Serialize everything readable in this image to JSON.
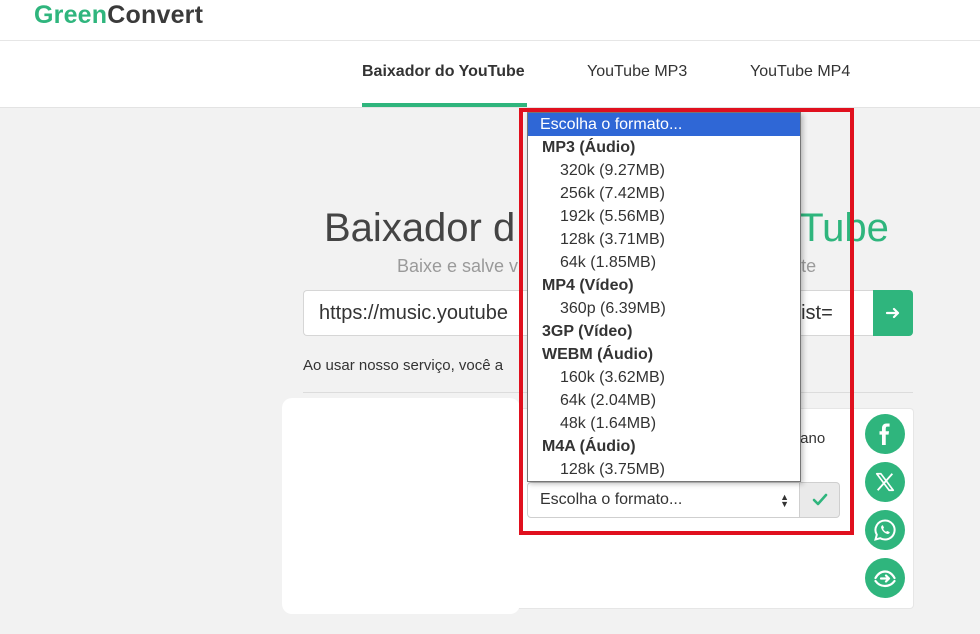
{
  "brand": {
    "part1": "Green",
    "part2": "Convert"
  },
  "nav": [
    {
      "label": "Baixador do YouTube",
      "active": true
    },
    {
      "label": "YouTube MP3",
      "active": false
    },
    {
      "label": "YouTube MP4",
      "active": false
    }
  ],
  "hero": {
    "title_left": "Baixador d",
    "title_right": "Tube",
    "subtitle_left": "Baixe e salve v",
    "subtitle_right": "te"
  },
  "url_input": {
    "value_left": "https://music.youtube",
    "value_right": "A&list="
  },
  "terms_text": "Ao usar nosso serviço, você a",
  "result": {
    "title_fragment": "fano"
  },
  "format_select": {
    "selected": "Escolha o formato...",
    "options": [
      {
        "kind": "selected",
        "label": "Escolha o formato..."
      },
      {
        "kind": "group",
        "label": "MP3 (Áudio)"
      },
      {
        "kind": "item",
        "label": "320k (9.27MB)"
      },
      {
        "kind": "item",
        "label": "256k (7.42MB)"
      },
      {
        "kind": "item",
        "label": "192k (5.56MB)"
      },
      {
        "kind": "item",
        "label": "128k (3.71MB)"
      },
      {
        "kind": "item",
        "label": "64k (1.85MB)"
      },
      {
        "kind": "group",
        "label": "MP4 (Vídeo)"
      },
      {
        "kind": "item",
        "label": "360p (6.39MB)"
      },
      {
        "kind": "group",
        "label": "3GP (Vídeo)"
      },
      {
        "kind": "group",
        "label": "WEBM (Áudio)"
      },
      {
        "kind": "item",
        "label": "160k (3.62MB)"
      },
      {
        "kind": "item",
        "label": "64k (2.04MB)"
      },
      {
        "kind": "item",
        "label": "48k (1.64MB)"
      },
      {
        "kind": "group",
        "label": "M4A (Áudio)"
      },
      {
        "kind": "item",
        "label": "128k (3.75MB)"
      }
    ]
  },
  "share_buttons": [
    "facebook-icon",
    "x-icon",
    "whatsapp-icon",
    "share-icon"
  ],
  "colors": {
    "accent": "#2fb57d",
    "highlight": "#2f67d6",
    "annotation": "#e0101e"
  }
}
